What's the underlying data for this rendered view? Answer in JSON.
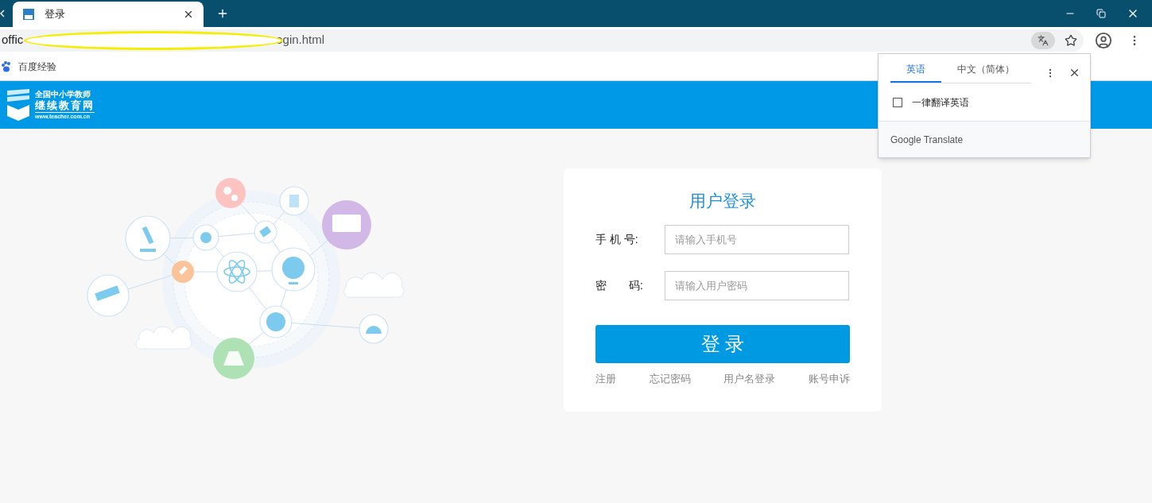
{
  "browser": {
    "tab": {
      "title": "登录"
    },
    "address_bar": {
      "visible_parts": [
        "offic",
        "ogin.html"
      ]
    },
    "bookmarks": [
      {
        "label": "百度经验"
      }
    ]
  },
  "site_header": {
    "logo": {
      "line_1": "全国中小学教师",
      "line_2": "继续教育网",
      "url": "www.teacher.com.cn"
    }
  },
  "login_card": {
    "title": "用户登录",
    "fields": [
      {
        "label": "手 机 号:",
        "placeholder": "请输入手机号"
      },
      {
        "label": "密　　码:",
        "placeholder": "请输入用户密码"
      }
    ],
    "submit": "登 录",
    "links": [
      "注册",
      "忘记密码",
      "用户名登录",
      "账号申诉"
    ]
  },
  "translate_popup": {
    "tabs": [
      {
        "label": "英语",
        "selected": true
      },
      {
        "label": "中文（简体）",
        "selected": false
      }
    ],
    "option": {
      "label": "一律翻译英语",
      "checked": false
    },
    "footer": {
      "brand": "Google",
      "product": "Translate"
    }
  }
}
